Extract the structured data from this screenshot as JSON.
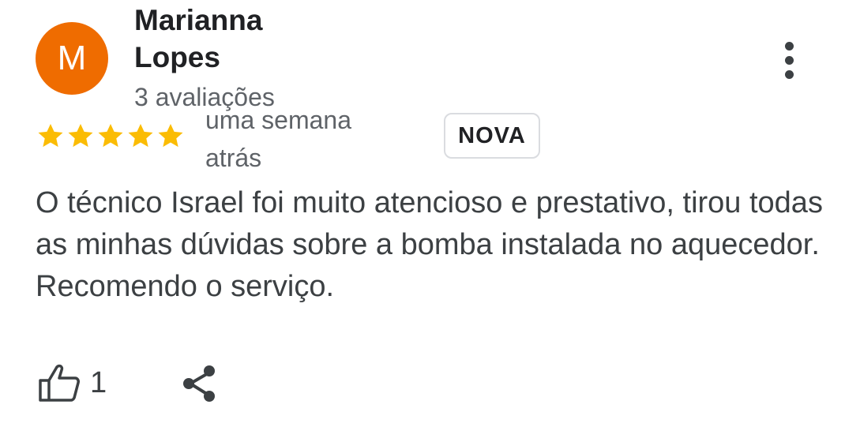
{
  "review": {
    "avatar_letter": "M",
    "avatar_color": "#ef6c00",
    "author_name": "Marianna Lopes",
    "review_count": "3 avaliações",
    "rating": 5,
    "rating_max": 5,
    "star_color": "#fbbc04",
    "time_ago": "uma semana atrás",
    "badge": "NOVA",
    "text": "O técnico Israel foi muito atencioso e prestativo, tirou todas as minhas dúvidas sobre a bomba instalada no aquecedor. Recomendo o serviço.",
    "like_count": "1",
    "icons": {
      "more": "more-vert-icon",
      "like": "thumb-up-icon",
      "share": "share-icon"
    }
  }
}
